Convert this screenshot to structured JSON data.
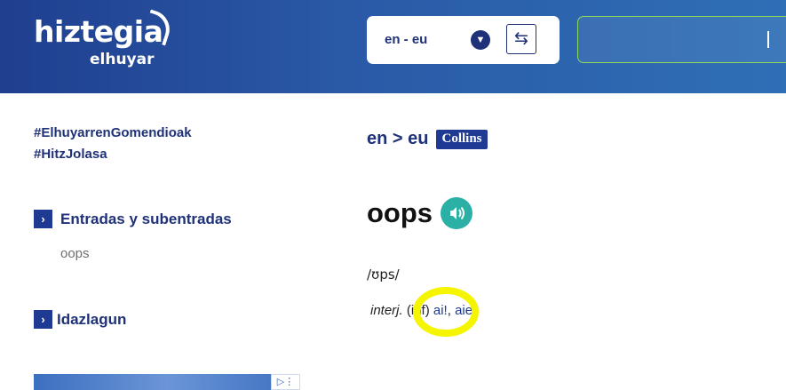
{
  "header": {
    "logo_main": "hiztegia",
    "logo_sub": "elhuyar",
    "language_pair": "en - eu",
    "search_value": ""
  },
  "sidebar": {
    "links": [
      "#ElhuyarrenGomendioak",
      "#HitzJolasa"
    ],
    "sections": [
      {
        "title": "Entradas y subentradas",
        "items": [
          "oops"
        ]
      },
      {
        "title": "Idazlagun"
      }
    ]
  },
  "main": {
    "direction": "en > eu",
    "source_badge": "Collins",
    "headword": "oops",
    "pronunciation": "/ʊps/",
    "definition": {
      "pos": "interj.",
      "register": "(inf)",
      "translations": [
        "ai!",
        "aiei!"
      ]
    }
  },
  "colors": {
    "brand_blue": "#1f3178",
    "header_gradient": [
      "#1f3f8f",
      "#2f6fb6"
    ],
    "audio_teal": "#2ab0a4",
    "highlight_yellow": "#f5f500",
    "search_border": "#8fd85a"
  },
  "icons": {
    "dropdown": "chevron-down-icon",
    "swap": "swap-arrows-icon",
    "audio": "speaker-icon",
    "section_arrow": "chevron-right-icon"
  }
}
